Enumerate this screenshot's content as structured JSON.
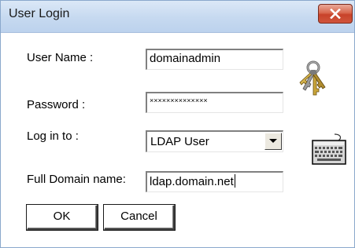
{
  "window": {
    "title": "User Login"
  },
  "form": {
    "username": {
      "label": "User Name :",
      "value": "domainadmin"
    },
    "password": {
      "label": "Password :",
      "masked_value": "××××××××××××××"
    },
    "login_to": {
      "label": "Log in to :",
      "selected": "LDAP User"
    },
    "domain": {
      "label": "Full Domain name:",
      "value": "ldap.domain.net"
    }
  },
  "buttons": {
    "ok": "OK",
    "cancel": "Cancel"
  },
  "icons": {
    "keys": "keys-icon",
    "keyboard": "keyboard-icon",
    "close": "close-icon",
    "dropdown": "chevron-down-icon"
  },
  "colors": {
    "titlebar": "#c6d9f0",
    "close_button": "#c8432a"
  }
}
